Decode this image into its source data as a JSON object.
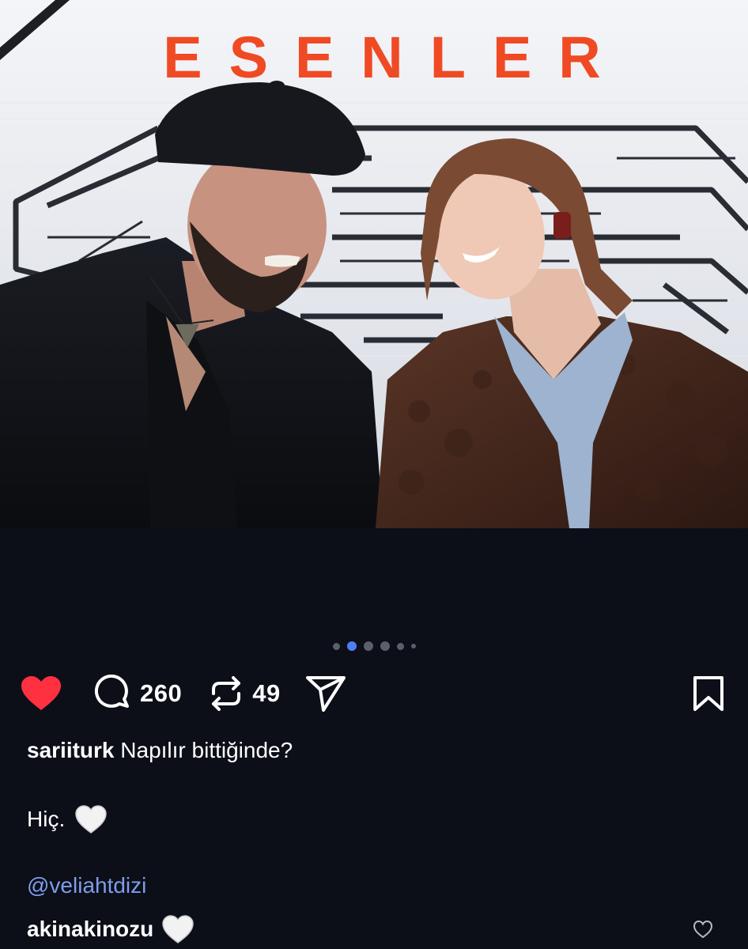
{
  "photo": {
    "banner_text": "ESENLER",
    "banner_color": "#f04a24"
  },
  "carousel": {
    "total": 6,
    "active_index": 1
  },
  "actions": {
    "like_icon": "heart-filled-icon",
    "liked": true,
    "like_color": "#ff3040",
    "comment_icon": "comment-bubble-icon",
    "comment_count": "260",
    "repost_icon": "repost-icon",
    "repost_count": "49",
    "share_icon": "send-icon",
    "save_icon": "bookmark-icon"
  },
  "caption": {
    "username": "sariiturk",
    "text": "Napılır bittiğinde?",
    "line2": "Hiç.",
    "line2_emoji": "white-heart-icon",
    "mention": "@veliahtdizi"
  },
  "comment": {
    "username": "akinakinozu",
    "emoji": "white-heart-icon",
    "like_icon": "heart-outline-icon"
  },
  "colors": {
    "background": "#0c0e18",
    "text": "#ffffff",
    "mention": "#7d9eea",
    "dot_active": "#4f7ef3",
    "dot_inactive": "#5b5f6b"
  }
}
